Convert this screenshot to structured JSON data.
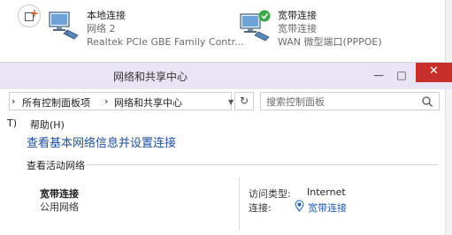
{
  "adapters": [
    {
      "name": "本地连接",
      "status": "网络  2",
      "device": "Realtek PCIe GBE Family Contr..."
    },
    {
      "name": "宽带连接",
      "status": "宽带连接",
      "device": "WAN 微型端口(PPPOE)"
    }
  ],
  "window": {
    "title": "网络和共享中心",
    "minimize": "—",
    "maximize": "□",
    "close": "✕"
  },
  "address": {
    "crumb_arrow": "›",
    "crumbs": [
      "所有控制面板项",
      "网络和共享中心"
    ],
    "dropdown": "▼",
    "refresh": "↻",
    "search_placeholder": "搜索控制面板"
  },
  "menu": {
    "item1": "T)",
    "item2": "帮助(H)"
  },
  "main": {
    "heading": "查看基本网络信息并设置连接",
    "active_label": "查看活动网络",
    "network_name": "宽带连接",
    "network_type": "公用网络",
    "access_type_label": "访问类型:",
    "access_type_value": "Internet",
    "connection_label": "连接:",
    "connection_value": "宽带连接"
  },
  "icons": {
    "scroll": "add-window-icon",
    "adapter": "network-adapter-icon",
    "connected_check": "check-icon",
    "search": "search-icon",
    "signal": "signal-icon"
  },
  "colors": {
    "titlebar": "#e9e4f3",
    "close_button": "#c7302a",
    "link_blue": "#1e4fa0",
    "accent_orange": "#e05a1a",
    "check_green": "#39a845"
  }
}
